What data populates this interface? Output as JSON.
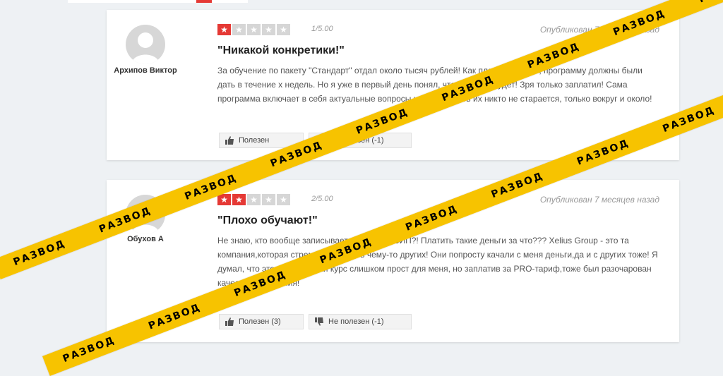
{
  "reviews": [
    {
      "author": "Архипов Виктор",
      "rating": 1,
      "score_text": "1/5.00",
      "published": "Опубликован 7 месяцев назад",
      "title": "\"Никакой конкретики!\"",
      "body": "За обучение по пакету \"Стандарт\" отдал около тысяч рублей! Как планировалось, программу должны были дать в течение х недель. Но я уже в первый день понял, что толку не будет! Зря только заплатил! Сама программа включает в себя актуальные вопросы,но раскрывать их никто не старается, только вокруг и около!",
      "useful_label": "Полезен",
      "not_useful_label": "Не полезен (-1)"
    },
    {
      "author": "Обухов А",
      "rating": 2,
      "score_text": "2/5.00",
      "published": "Опубликован 7 месяцев назад",
      "title": "\"Плохо обучают!\"",
      "body": "Не знаю, кто вообще записывается в группу ВИП?! Платить такие деньги за что??? Xelius Group - это та компания,которая стремится научить чему-то других! Они попросту качали с меня деньги,да и с других тоже! Я думал, что это стандартный курс слишком прост для меня, но заплатив за PRO-тариф,тоже был разочарован качеством обучения!",
      "useful_label": "Полезен (3)",
      "not_useful_label": "Не полезен (-1)"
    }
  ],
  "tape_text": "РАЗВОД",
  "colors": {
    "star_on": "#e53935",
    "star_off": "#d6d6d6",
    "tape": "#f7c300"
  },
  "icons": {
    "thumb_up": "thumb-up-icon",
    "thumb_down": "thumb-down-icon",
    "star": "star-icon",
    "avatar": "user-avatar-icon"
  }
}
